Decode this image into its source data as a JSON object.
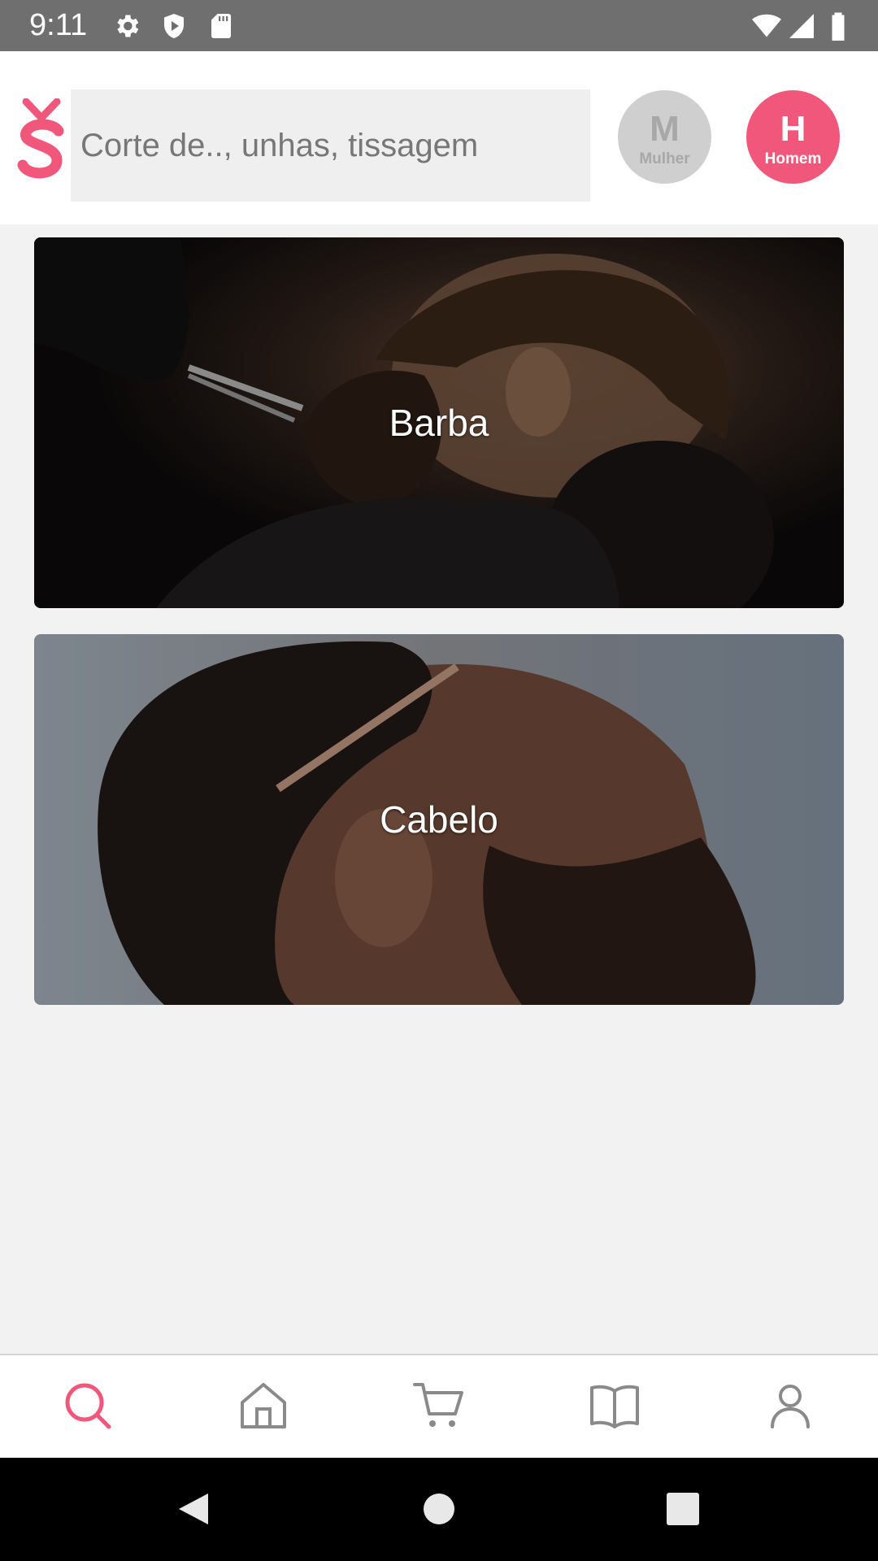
{
  "status_bar": {
    "time": "9:11",
    "icons_left": [
      "gear-icon",
      "shield-icon",
      "sd-card-icon"
    ],
    "icons_right": [
      "wifi-icon",
      "signal-icon",
      "battery-icon"
    ]
  },
  "header": {
    "logo_icon": "brand-logo-icon",
    "brand_color": "#f0577a",
    "search": {
      "placeholder": "Corte de.., unhas, tissagem",
      "value": ""
    },
    "gender_filters": [
      {
        "letter": "M",
        "label": "Mulher",
        "selected": false
      },
      {
        "letter": "H",
        "label": "Homem",
        "selected": true
      }
    ]
  },
  "categories": [
    {
      "label": "Barba"
    },
    {
      "label": "Cabelo"
    }
  ],
  "bottom_nav": {
    "active_color": "#f0577a",
    "inactive_color": "#8a8a8a",
    "items": [
      {
        "icon": "search-icon",
        "active": true
      },
      {
        "icon": "home-icon",
        "active": false
      },
      {
        "icon": "cart-icon",
        "active": false
      },
      {
        "icon": "book-icon",
        "active": false
      },
      {
        "icon": "profile-icon",
        "active": false
      }
    ]
  },
  "system_nav": {
    "icons": [
      "back-icon",
      "home-circle-icon",
      "recents-icon"
    ]
  }
}
